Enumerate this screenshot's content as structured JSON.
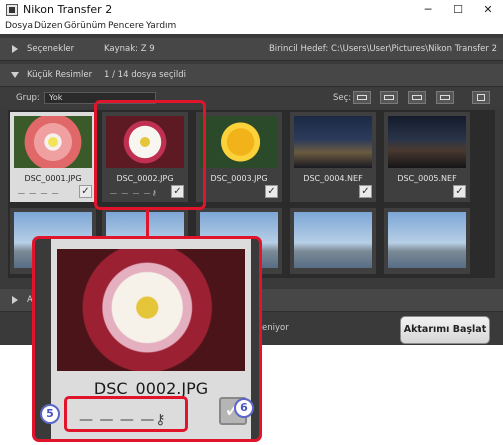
{
  "window": {
    "title": "Nikon Transfer 2",
    "minimize": "─",
    "maximize": "☐",
    "close": "✕"
  },
  "menu": [
    "Dosya",
    "Düzen",
    "Görünüm",
    "Pencere",
    "Yardım"
  ],
  "options_row": {
    "label": "Seçenekler",
    "source": "Kaynak: Z 9",
    "destination": "Birincil Hedef: C:\\Users\\User\\Pictures\\Nikon Transfer 2"
  },
  "thumbnails_row": {
    "label": "Küçük Resimler",
    "count": "1 / 14 dosya seçildi"
  },
  "toolbar": {
    "group_label": "Grup:",
    "group_value": "Yok",
    "select_label": "Seç:"
  },
  "thumbnails_row1": [
    {
      "name": "DSC_0001.JPG",
      "dashes": "— — — —",
      "checked": "✓",
      "image": "pink-flower"
    },
    {
      "name": "DSC_0002.JPG",
      "dashes": "— — — —⚷",
      "checked": "✓",
      "image": "white-flower",
      "selected": true
    },
    {
      "name": "DSC_0003.JPG",
      "dashes": "",
      "checked": "✓",
      "image": "yellow-flower"
    },
    {
      "name": "DSC_0004.NEF",
      "dashes": "",
      "checked": "✓",
      "image": "night-city"
    },
    {
      "name": "DSC_0005.NEF",
      "dashes": "",
      "checked": "✓",
      "image": "night-city"
    }
  ],
  "collapsed_row": {
    "label": "A"
  },
  "progress": {
    "text": "eniyor"
  },
  "start_button": "Aktarımı Başlat",
  "zoom": {
    "name": "DSC_0002.JPG",
    "dashes": "— — — —⚷",
    "check": "✓"
  },
  "markers": {
    "five": "5",
    "six": "6"
  },
  "colors": {
    "callout": "#e0152b",
    "marker": "#4a56c0",
    "app_bg": "#3a3a3a"
  }
}
